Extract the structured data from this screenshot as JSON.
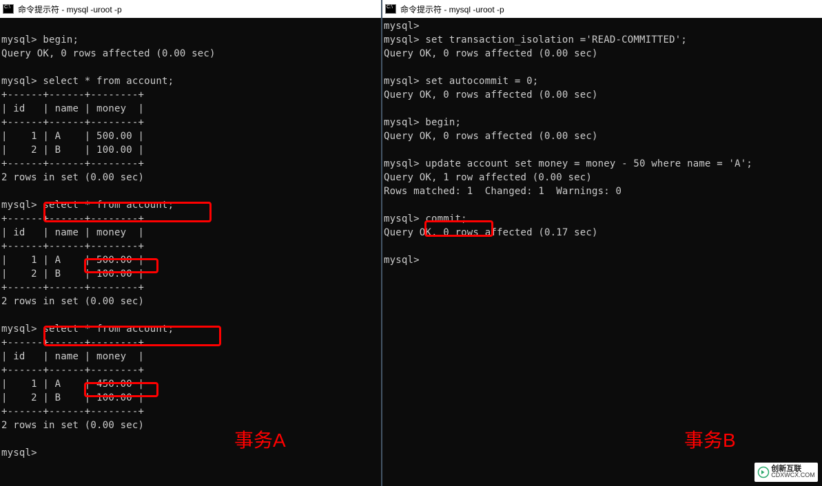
{
  "left": {
    "title": "命令提示符 - mysql  -uroot -p",
    "prompt": "mysql>",
    "lines": {
      "l1": "mysql> begin;",
      "l2": "Query OK, 0 rows affected (0.00 sec)",
      "l3": "mysql> select * from account;",
      "sep": "+------+------+--------+",
      "sepTop": "+------+------+--------+",
      "hdr": "| id   | name | money  |",
      "r1a": "|    1 | A    | 500.00 |",
      "r2a": "|    2 | B    | 100.00 |",
      "rowsMsg": "2 rows in set (0.00 sec)",
      "l4": "mysql> select * from account;",
      "r1b": "|    1 | A    | 500.00 |",
      "r2b": "|    2 | B    | 100.00 |",
      "l5": "mysql> select * from account;",
      "r1c": "|    1 | A    | 450.00 |",
      "r2c": "|    2 | B    | 100.00 |",
      "lastPrompt": "mysql>"
    },
    "label": "事务A"
  },
  "right": {
    "title": "命令提示符 - mysql  -uroot -p",
    "lines": {
      "p0": "mysql>",
      "l1": "mysql> set transaction_isolation ='READ-COMMITTED';",
      "ok": "Query OK, 0 rows affected (0.00 sec)",
      "l2": "mysql> set autocommit = 0;",
      "l3": "mysql> begin;",
      "l4": "mysql> update account set money = money - 50 where name = 'A';",
      "ok1row": "Query OK, 1 row affected (0.00 sec)",
      "matched": "Rows matched: 1  Changed: 1  Warnings: 0",
      "l5": "mysql> commit;",
      "ok017": "Query OK, 0 rows affected (0.17 sec)",
      "lastPrompt": "mysql>"
    },
    "label": "事务B"
  },
  "watermark": {
    "cn": "创新互联",
    "en": "CDXWCX.COM"
  }
}
